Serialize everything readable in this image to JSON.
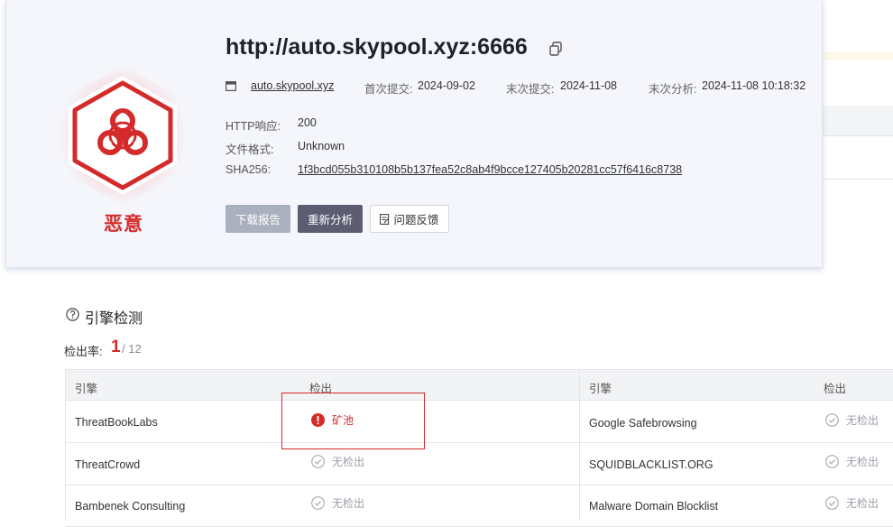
{
  "report": {
    "url_title": "http://auto.skypool.xyz:6666",
    "domain_link": "auto.skypool.xyz",
    "verdict": "恶意",
    "first_submit_label": "首次提交:",
    "first_submit_value": "2024-09-02",
    "last_submit_label": "末次提交:",
    "last_submit_value": "2024-11-08",
    "last_analysis_label": "末次分析:",
    "last_analysis_value": "2024-11-08 10:18:32",
    "http_label": "HTTP响应:",
    "http_value": "200",
    "format_label": "文件格式:",
    "format_value": "Unknown",
    "sha_label": "SHA256:",
    "sha_value": "1f3bcd055b310108b5b137fea52c8ab4f9bcce127405b20281cc57f6416c8738"
  },
  "actions": {
    "download": "下载报告",
    "reanalyze": "重新分析",
    "feedback": "问题反馈"
  },
  "engines": {
    "section_title": "引擎检测",
    "rate_label": "检出率:",
    "detected": "1",
    "total": "/ 12",
    "col_engine": "引擎",
    "col_result": "检出",
    "rows": [
      {
        "left_engine": "ThreatBookLabs",
        "left_result": "矿池",
        "right_engine": "Google Safebrowsing",
        "right_result": "无检出"
      },
      {
        "left_engine": "ThreatCrowd",
        "left_result": "无检出",
        "right_engine": "SQUIDBLACKLIST.ORG",
        "right_result": "无检出"
      },
      {
        "left_engine": "Bambenek Consulting",
        "left_result": "无检出",
        "right_engine": "Malware Domain Blocklist",
        "right_result": "无检出"
      }
    ]
  },
  "colors": {
    "malicious": "#d42a2a",
    "card_bg": "#f4f6fb",
    "button_dark": "#5b5e72",
    "button_disabled": "#aab0bd"
  }
}
